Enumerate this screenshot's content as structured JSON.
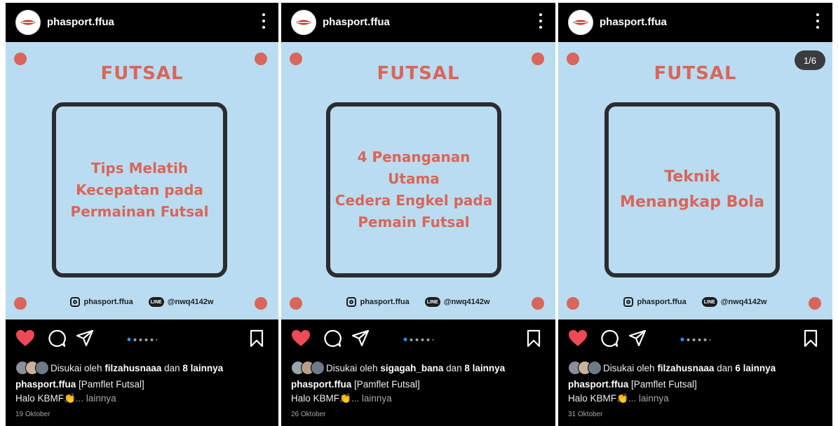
{
  "posts": [
    {
      "username": "phasport.ffua",
      "title": "FUTSAL",
      "frame_text": "Tips Melatih\nKecepatan pada\nPermainan Futsal",
      "instagram_handle": "phasport.ffua",
      "line_handle": "@nwq4142w",
      "line_label": "LINE",
      "counter": "",
      "liked_prefix": "Disukai oleh",
      "liked_user": "filzahusnaaa",
      "liked_joiner": "dan",
      "liked_others": "8 lainnya",
      "caption_user": "phasport.ffua",
      "caption_text": "[Pamflet Futsal]",
      "caption_line2": "Halo KBMF👏",
      "more": "... lainnya",
      "date": "19 Oktober"
    },
    {
      "username": "phasport.ffua",
      "title": "FUTSAL",
      "frame_text": "4 Penanganan Utama\nCedera Engkel pada\nPemain Futsal",
      "instagram_handle": "phasport.ffua",
      "line_handle": "@nwq4142w",
      "line_label": "LINE",
      "counter": "",
      "liked_prefix": "Disukai oleh",
      "liked_user": "sigagah_bana",
      "liked_joiner": "dan",
      "liked_others": "8 lainnya",
      "caption_user": "phasport.ffua",
      "caption_text": "[Pamflet Futsal]",
      "caption_line2": "Halo KBMF👏",
      "more": "... lainnya",
      "date": "26 Oktober"
    },
    {
      "username": "phasport.ffua",
      "title": "FUTSAL",
      "frame_text": "Teknik\nMenangkap Bola",
      "instagram_handle": "phasport.ffua",
      "line_handle": "@nwq4142w",
      "line_label": "LINE",
      "counter": "1/6",
      "liked_prefix": "Disukai oleh",
      "liked_user": "filzahusnaaa",
      "liked_joiner": "dan",
      "liked_others": "6 lainnya",
      "caption_user": "phasport.ffua",
      "caption_text": "[Pamflet Futsal]",
      "caption_line2": "Halo KBMF👏",
      "more": "... lainnya",
      "date": "31 Oktober"
    }
  ],
  "colors": {
    "post_background": "#badcf1",
    "accent": "#d9665a",
    "frame": "#2a2c30",
    "like": "#ed4956",
    "carousel_active": "#2f8ff0"
  },
  "icons": [
    "heart-icon",
    "comment-icon",
    "share-icon",
    "bookmark-icon",
    "more-options-icon",
    "instagram-icon",
    "line-icon"
  ]
}
